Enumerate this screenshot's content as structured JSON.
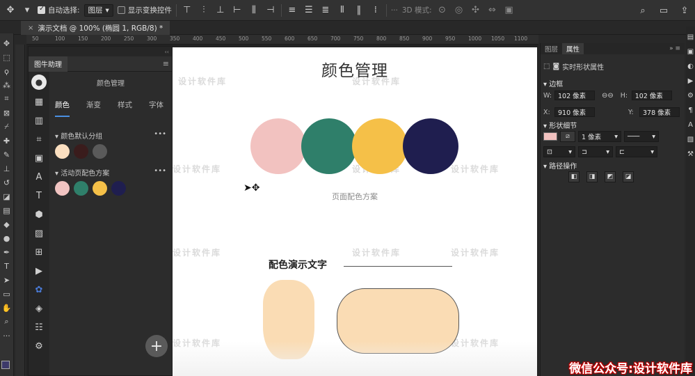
{
  "options_bar": {
    "auto_select_label": "自动选择:",
    "auto_select_target": "图层",
    "show_transform_label": "显示变换控件",
    "mode_3d_label": "3D 模式:",
    "more_label": "···"
  },
  "document_tab": {
    "title": "演示文档 @ 100% (椭圆 1, RGB/8) *",
    "close": "×"
  },
  "ruler_ticks": [
    "50",
    "100",
    "150",
    "200",
    "250",
    "300",
    "350",
    "400",
    "450",
    "500",
    "550",
    "600",
    "650",
    "700",
    "750",
    "800",
    "850",
    "900",
    "950",
    "1000",
    "1050",
    "1100"
  ],
  "plugin_panel": {
    "tab_label": "图牛助理",
    "section_title": "颜色管理",
    "tabs": [
      "颜色",
      "渐变",
      "样式",
      "字体"
    ],
    "active_tab": "颜色",
    "groups": [
      {
        "label": "颜色默认分组",
        "swatches": [
          "#fbdfc0",
          "#3a1c1c",
          "#5a5a5a"
        ]
      },
      {
        "label": "活动页配色方案",
        "swatches": [
          "#f1c4c2",
          "#2f7f6a",
          "#f5c048",
          "#1f1e4f"
        ]
      }
    ],
    "add_button": "+"
  },
  "canvas": {
    "title": "颜色管理",
    "palette_caption": "页面配色方案",
    "palette": [
      "#f2c2c0",
      "#2f7f6a",
      "#f5c048",
      "#1f1e4f"
    ],
    "demo_text": "配色演示文字",
    "sample_fill": "#fadcb4",
    "watermark_text": "设计软件库"
  },
  "properties_panel": {
    "tabs": [
      "图层",
      "属性"
    ],
    "active_tab": "属性",
    "shape_label": "实时形状属性",
    "bounds_label": "边框",
    "w_label": "W:",
    "w_value": "102 像素",
    "h_label": "H:",
    "h_value": "102 像素",
    "x_label": "X:",
    "x_value": "910 像素",
    "y_label": "Y:",
    "y_value": "378 像素",
    "shape_details_label": "形状细节",
    "stroke_width": "1 像素",
    "path_ops_label": "路径操作",
    "fill_color": "#f2c2c0"
  },
  "footer_watermark": "微信公众号:设计软件库"
}
